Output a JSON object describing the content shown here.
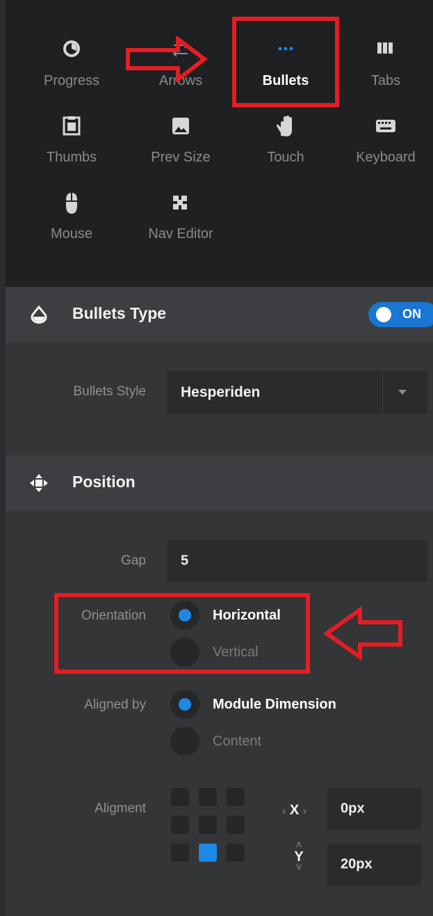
{
  "nav": {
    "items": [
      {
        "label": "Progress",
        "icon": "progress-icon"
      },
      {
        "label": "Arrows",
        "icon": "arrows-icon"
      },
      {
        "label": "Bullets",
        "icon": "bullets-icon",
        "active": true
      },
      {
        "label": "Tabs",
        "icon": "tabs-icon"
      },
      {
        "label": "Thumbs",
        "icon": "thumbs-icon"
      },
      {
        "label": "Prev Size",
        "icon": "image-icon"
      },
      {
        "label": "Touch",
        "icon": "hand-icon"
      },
      {
        "label": "Keyboard",
        "icon": "keyboard-icon"
      },
      {
        "label": "Mouse",
        "icon": "mouse-icon"
      },
      {
        "label": "Nav Editor",
        "icon": "puzzle-icon"
      }
    ]
  },
  "bullets_type": {
    "title": "Bullets Type",
    "toggle": "ON",
    "style_label": "Bullets Style",
    "style_value": "Hesperiden"
  },
  "position": {
    "title": "Position",
    "gap_label": "Gap",
    "gap_value": "5",
    "orientation_label": "Orientation",
    "orientation_options": [
      "Horizontal",
      "Vertical"
    ],
    "aligned_label": "Aligned by",
    "aligned_options": [
      "Module Dimension",
      "Content"
    ],
    "alignment_label": "Aligment",
    "x_label": "X",
    "x_value": "0px",
    "y_label": "Y",
    "y_value": "20px"
  },
  "colors": {
    "accent": "#1e88e5",
    "annotation": "#e31e24"
  }
}
